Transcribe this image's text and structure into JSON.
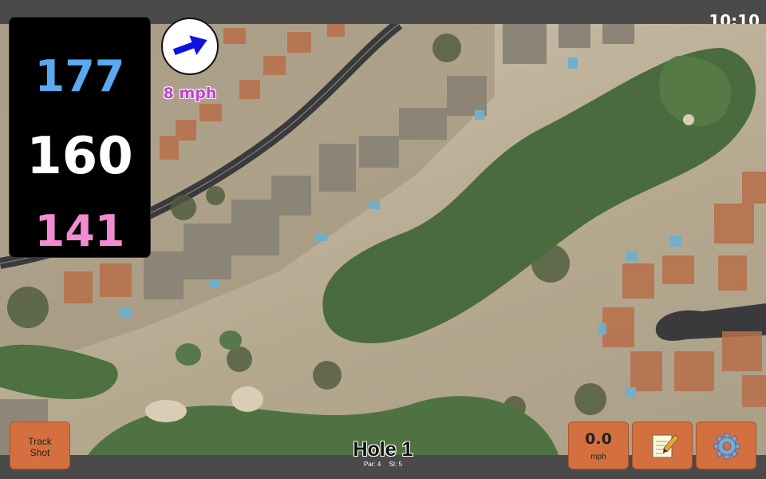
{
  "status_bar": {
    "time": "10:10"
  },
  "distances": {
    "back": "177",
    "middle": "160",
    "front": "141",
    "colors": {
      "back": "#5aa8f0",
      "middle": "#ffffff",
      "front": "#f08ccf"
    }
  },
  "wind": {
    "speed_label": "8 mph",
    "indicator_icon": "wind-direction-arrow-icon",
    "arrow_color": "#1010e0",
    "label_color": "#c040d0"
  },
  "hole": {
    "title": "Hole 1",
    "par_label": "Par: 4",
    "si_label": "SI: 5"
  },
  "buttons": {
    "track_shot": {
      "line1": "Track",
      "line2": "Shot"
    },
    "wind_input": {
      "value": "0.0",
      "unit": "mph"
    },
    "notes": {
      "icon": "notepad-icon"
    },
    "settings": {
      "icon": "gear-icon"
    },
    "accent_color": "#d4703f"
  },
  "map": {
    "view": "satellite",
    "icon": "satellite-map"
  }
}
